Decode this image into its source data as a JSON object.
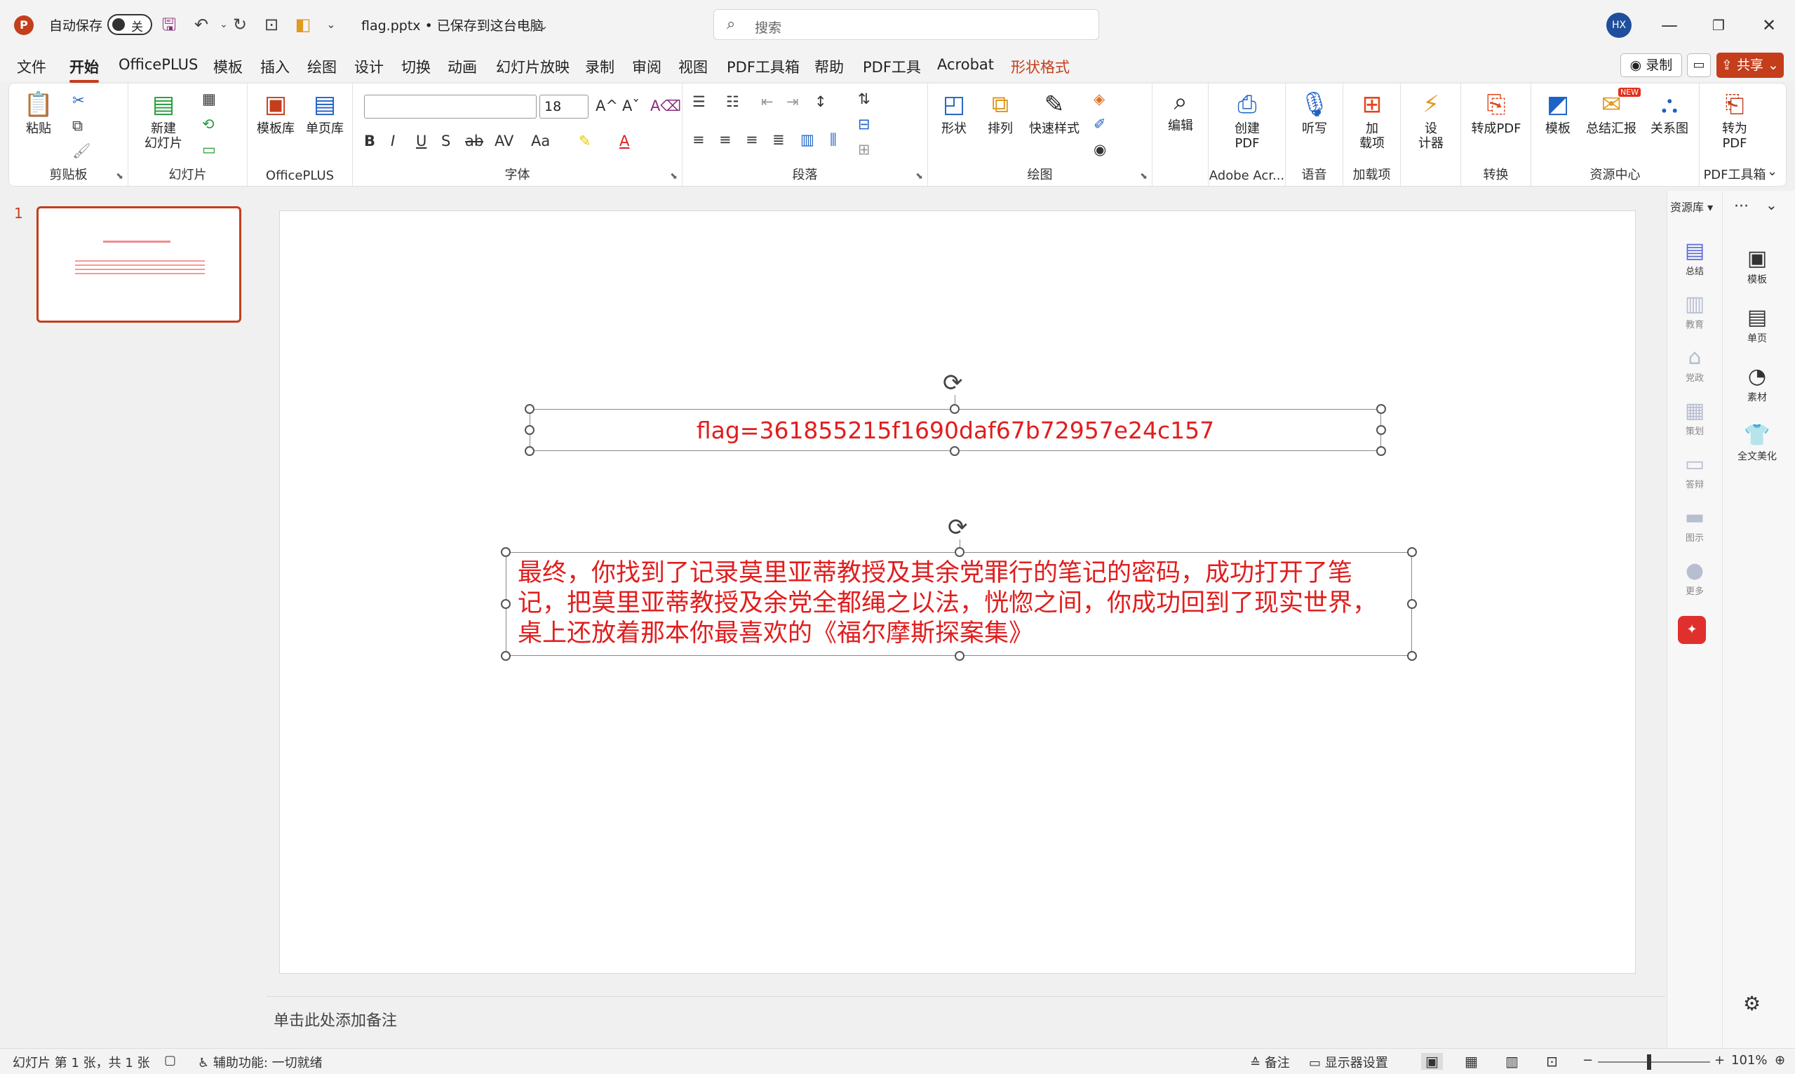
{
  "titlebar": {
    "app_logo": "P",
    "autosave_label": "自动保存",
    "autosave_state": "关",
    "doc_title": "flag.pptx • 已保存到这台电脑",
    "search_placeholder": "搜索",
    "avatar_initials": "HX"
  },
  "tabs": [
    {
      "label": "文件"
    },
    {
      "label": "开始"
    },
    {
      "label": "OfficePLUS"
    },
    {
      "label": "模板"
    },
    {
      "label": "插入"
    },
    {
      "label": "绘图"
    },
    {
      "label": "设计"
    },
    {
      "label": "切换"
    },
    {
      "label": "动画"
    },
    {
      "label": "幻灯片放映"
    },
    {
      "label": "录制"
    },
    {
      "label": "审阅"
    },
    {
      "label": "视图"
    },
    {
      "label": "PDF工具箱"
    },
    {
      "label": "帮助"
    },
    {
      "label": "PDF工具"
    },
    {
      "label": "Acrobat"
    },
    {
      "label": "形状格式"
    }
  ],
  "tab_actions": {
    "record": "录制",
    "share": "共享"
  },
  "ribbon": {
    "clipboard": {
      "label": "剪贴板",
      "paste": "粘贴"
    },
    "slides": {
      "label": "幻灯片",
      "new_slide_1": "新建",
      "new_slide_2": "幻灯片"
    },
    "officeplus": {
      "label": "OfficePLUS",
      "template_lib": "模板库",
      "single_page_lib": "单页库"
    },
    "font": {
      "label": "字体",
      "font_name": "",
      "font_size": "18"
    },
    "paragraph": {
      "label": "段落"
    },
    "drawing": {
      "label": "绘图",
      "shape": "形状",
      "arrange": "排列",
      "quick_style": "快速样式"
    },
    "editing": {
      "edit": "编辑"
    },
    "adobe": {
      "label": "Adobe Acr...",
      "create_pdf_1": "创建",
      "create_pdf_2": "PDF"
    },
    "voice": {
      "label": "语音",
      "dictate": "听写"
    },
    "addins": {
      "label": "加载项",
      "addin_1": "加",
      "addin_2": "载项"
    },
    "designer": {
      "designer_1": "设",
      "designer_2": "计器"
    },
    "convert": {
      "label": "转换",
      "to_pdf": "转成PDF"
    },
    "resource_center": {
      "label": "资源中心",
      "template": "模板",
      "summary_report": "总结汇报",
      "relation_chart": "关系图",
      "new_badge": "NEW"
    },
    "pdf_toolbox": {
      "label": "PDF工具箱",
      "to_pdf_1": "转为",
      "to_pdf_2": "PDF"
    }
  },
  "thumbnails": {
    "slide_number": "1"
  },
  "slide": {
    "flag_text": "flag=361855215f1690daf67b72957e24c157",
    "story_line_1": "最终，你找到了记录莫里亚蒂教授及其余党罪行的笔记的密码，成功打开了笔",
    "story_line_2": "记，把莫里亚蒂教授及余党全都绳之以法，恍惚之间，你成功回到了现实世界，",
    "story_line_3": "桌上还放着那本你最喜欢的《福尔摩斯探案集》"
  },
  "notes": {
    "placeholder": "单击此处添加备注"
  },
  "right_panel": {
    "resource_lib": "资源库",
    "col_a": [
      {
        "label": "总结",
        "icon": "summary-icon"
      },
      {
        "label": "教育",
        "icon": "education-icon"
      },
      {
        "label": "党政",
        "icon": "government-icon"
      },
      {
        "label": "策划",
        "icon": "planning-icon"
      },
      {
        "label": "答辩",
        "icon": "defense-icon"
      },
      {
        "label": "图示",
        "icon": "diagram-icon"
      },
      {
        "label": "更多",
        "icon": "more-icon"
      }
    ],
    "col_b": [
      {
        "label": "模板",
        "icon": "template-icon"
      },
      {
        "label": "单页",
        "icon": "single-page-icon"
      },
      {
        "label": "素材",
        "icon": "material-icon"
      },
      {
        "label": "全文美化",
        "icon": "beautify-icon"
      }
    ]
  },
  "statusbar": {
    "slide_info": "幻灯片 第 1 张，共 1 张",
    "accessibility": "辅助功能: 一切就绪",
    "notes": "备注",
    "display_settings": "显示器设置",
    "zoom": "101%"
  },
  "colors": {
    "accent": "#c43e1c",
    "slide_text": "#e01e1e"
  }
}
